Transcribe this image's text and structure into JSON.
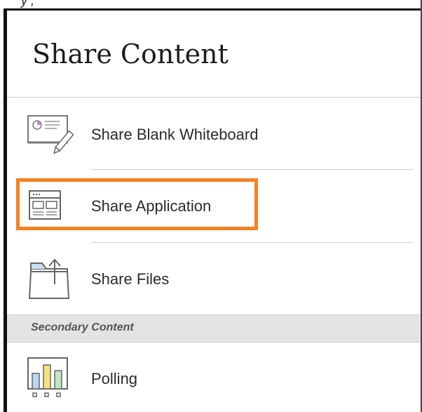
{
  "top_cropped_text": "y                                                    ,",
  "panel": {
    "title": "Share Content"
  },
  "items": [
    {
      "label": "Share Blank Whiteboard",
      "icon": "whiteboard-icon"
    },
    {
      "label": "Share Application",
      "icon": "application-window-icon",
      "highlighted": true
    },
    {
      "label": "Share Files",
      "icon": "folder-upload-icon"
    }
  ],
  "secondary": {
    "header": "Secondary Content",
    "items": [
      {
        "label": "Polling",
        "icon": "polling-chart-icon"
      }
    ]
  },
  "colors": {
    "highlight": "#f58220",
    "section_bg": "#e3e3e3",
    "divider": "#cfcfcf"
  }
}
